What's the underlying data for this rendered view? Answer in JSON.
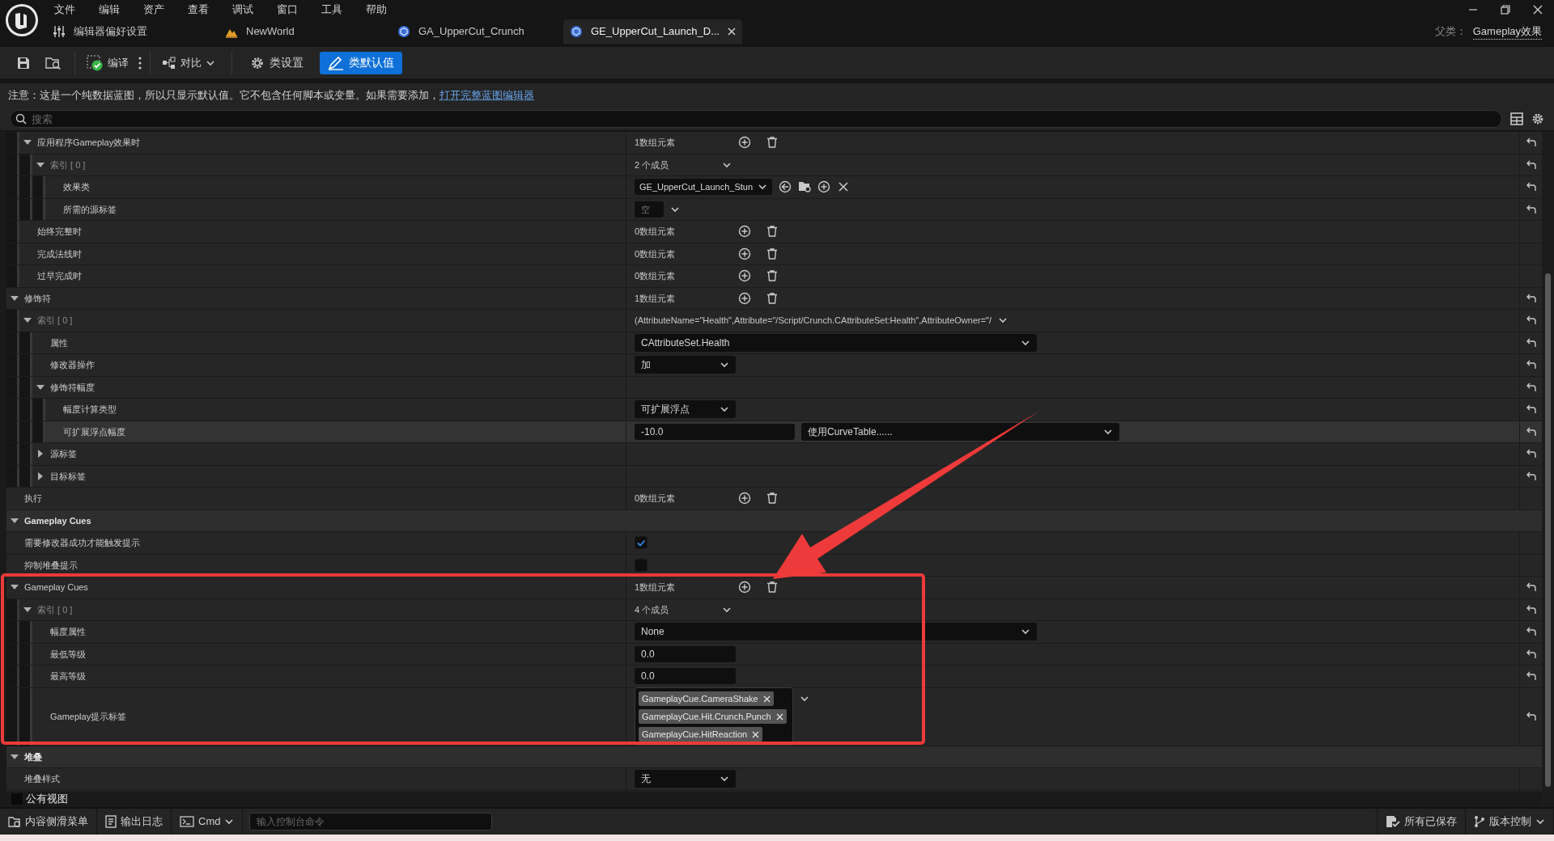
{
  "menu": [
    "文件",
    "编辑",
    "资产",
    "查看",
    "调试",
    "窗口",
    "工具",
    "帮助"
  ],
  "tabs": [
    {
      "label": "编辑器偏好设置",
      "kind": "prefs",
      "selected": false,
      "closable": false
    },
    {
      "label": "NewWorld",
      "kind": "level",
      "selected": false,
      "closable": false
    },
    {
      "label": "GA_UpperCut_Crunch",
      "kind": "blueprint",
      "selected": false,
      "closable": false
    },
    {
      "label": "GE_UpperCut_Launch_D...",
      "kind": "blueprint",
      "selected": true,
      "closable": true
    }
  ],
  "parent_class": {
    "label": "父类：",
    "value": "Gameplay效果"
  },
  "toolbar": {
    "compile": "编译",
    "diff": "对比",
    "modes": [
      {
        "label": "类设置",
        "kind": "settings",
        "selected": false
      },
      {
        "label": "类默认值",
        "kind": "defaults",
        "selected": true
      }
    ]
  },
  "notice": {
    "text": "注意：这是一个纯数据蓝图，所以只显示默认值。它不包含任何脚本或变量。如果需要添加，",
    "link": "打开完整蓝图编辑器"
  },
  "search": {
    "placeholder": "搜索"
  },
  "details": {
    "partial_rows": [
      {
        "label": "应用程序Gameplay效果时",
        "kind": "property",
        "expanded": true,
        "resettable": true,
        "value": {
          "kind": "array",
          "text": "1数组元素"
        },
        "children": [
          {
            "label": "索引 [ 0 ]",
            "kind": "index",
            "expanded": true,
            "resettable": true,
            "value": {
              "kind": "members",
              "text": "2 个成员"
            },
            "children": [
              {
                "label": "效果类",
                "kind": "property",
                "resettable": true,
                "value": {
                  "kind": "class_picker",
                  "text": "GE_UpperCut_Launch_Stun"
                }
              },
              {
                "label": "所需的源标签",
                "kind": "property",
                "resettable": true,
                "value": {
                  "kind": "tag_empty",
                  "text": "空"
                }
              }
            ]
          }
        ]
      },
      {
        "label": "始终完整时",
        "kind": "property",
        "resettable": false,
        "value": {
          "kind": "array",
          "text": "0数组元素"
        }
      },
      {
        "label": "完成法线时",
        "kind": "property",
        "resettable": false,
        "value": {
          "kind": "array",
          "text": "0数组元素"
        }
      },
      {
        "label": "过早完成时",
        "kind": "property",
        "resettable": false,
        "value": {
          "kind": "array",
          "text": "0数组元素"
        }
      }
    ],
    "rows": [
      {
        "label": "修饰符",
        "kind": "property",
        "expanded": true,
        "resettable": true,
        "value": {
          "kind": "array",
          "text": "1数组元素"
        },
        "children": [
          {
            "label": "索引 [ 0 ]",
            "kind": "index",
            "expanded": true,
            "resettable": true,
            "value": {
              "kind": "struct_text",
              "text": "(AttributeName=\"Health\",Attribute=\"/Script/Crunch.CAttributeSet:Health\",AttributeOwner=\"/"
            },
            "children": [
              {
                "label": "属性",
                "kind": "property",
                "resettable": true,
                "value": {
                  "kind": "wide_combo",
                  "text": "CAttributeSet.Health"
                }
              },
              {
                "label": "修改器操作",
                "kind": "property",
                "resettable": true,
                "value": {
                  "kind": "combo",
                  "text": "加"
                }
              },
              {
                "label": "修饰符幅度",
                "kind": "property",
                "expanded": true,
                "resettable": true,
                "children": [
                  {
                    "label": "幅度计算类型",
                    "kind": "property",
                    "resettable": true,
                    "highlighted": false,
                    "value": {
                      "kind": "combo",
                      "text": "可扩展浮点"
                    }
                  },
                  {
                    "label": "可扩展浮点幅度",
                    "kind": "property",
                    "resettable": true,
                    "highlighted": true,
                    "value": {
                      "kind": "number_curve",
                      "text": "-10.0",
                      "curve": "使用CurveTable......"
                    }
                  }
                ]
              },
              {
                "label": "源标签",
                "kind": "property",
                "expanded": false,
                "resettable": true
              },
              {
                "label": "目标标签",
                "kind": "property",
                "expanded": false,
                "resettable": true
              }
            ]
          }
        ]
      },
      {
        "label": "执行",
        "kind": "property",
        "resettable": false,
        "value": {
          "kind": "array",
          "text": "0数组元素"
        }
      },
      {
        "label": "Gameplay Cues",
        "kind": "category",
        "expanded": true,
        "resettable": false,
        "rows": [
          {
            "label": "需要修改器成功才能触发提示",
            "kind": "property",
            "resettable": false,
            "value": {
              "kind": "checkbox",
              "checked": true
            }
          },
          {
            "label": "抑制堆叠提示",
            "kind": "property",
            "resettable": false,
            "value": {
              "kind": "checkbox",
              "checked": false
            }
          },
          {
            "label": "Gameplay Cues",
            "kind": "property",
            "expanded": true,
            "resettable": true,
            "value": {
              "kind": "array",
              "text": "1数组元素"
            },
            "children": [
              {
                "label": "索引 [ 0 ]",
                "kind": "index",
                "expanded": true,
                "resettable": true,
                "value": {
                  "kind": "members",
                  "text": "4 个成员"
                },
                "children": [
                  {
                    "label": "幅度属性",
                    "kind": "property",
                    "resettable": true,
                    "value": {
                      "kind": "wide_combo",
                      "text": "None"
                    }
                  },
                  {
                    "label": "最低等级",
                    "kind": "property",
                    "resettable": true,
                    "value": {
                      "kind": "number",
                      "text": "0.0"
                    }
                  },
                  {
                    "label": "最高等级",
                    "kind": "property",
                    "resettable": true,
                    "value": {
                      "kind": "number",
                      "text": "0.0"
                    }
                  },
                  {
                    "label": "Gameplay提示标签",
                    "kind": "property",
                    "resettable": true,
                    "value": {
                      "kind": "tags",
                      "tags": [
                        "GameplayCue.CameraShake",
                        "GameplayCue.Hit.Crunch.Punch",
                        "GameplayCue.HitReaction"
                      ]
                    }
                  }
                ]
              }
            ]
          }
        ]
      },
      {
        "label": "堆叠",
        "kind": "category",
        "expanded": true,
        "resettable": false,
        "rows": [
          {
            "label": "堆叠样式",
            "kind": "property",
            "resettable": false,
            "value": {
              "kind": "combo",
              "text": "无"
            }
          }
        ]
      }
    ]
  },
  "public_view": {
    "label": "公有视图",
    "checked": false
  },
  "status_bar": {
    "content_drawer": "内容侧滑菜单",
    "output_log": "输出日志",
    "cmd": "Cmd",
    "console": {
      "placeholder": "输入控制台命令"
    },
    "saved": "所有已保存",
    "source_control": "版本控制"
  }
}
